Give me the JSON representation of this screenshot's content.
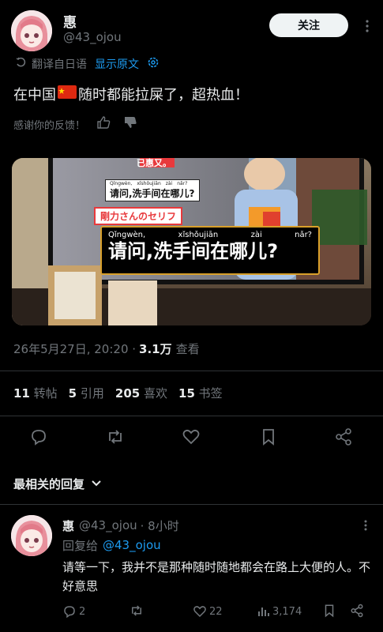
{
  "author": {
    "name": "惠",
    "handle": "@43_ojou"
  },
  "follow_label": "关注",
  "translate": {
    "label": "翻译自日语",
    "show_original": "显示原文"
  },
  "post_text": "在中国",
  "post_text2": "随时都能拉屎了，超热血！",
  "feedback": {
    "label": "感谢你的反馈！"
  },
  "media": {
    "banner": "已惠又。",
    "small_pinyin": [
      "Qǐngwèn,",
      "xǐshǒujiān",
      "zài",
      "nǎr?"
    ],
    "small_caption": "请问,洗手间在哪儿?",
    "tag": "剛力さんのセリフ",
    "pinyin": [
      "Qǐngwèn,",
      "xǐshǒujiān",
      "zài",
      "nǎr?"
    ],
    "caption": "请问,洗手间在哪儿?"
  },
  "meta": {
    "date": "26年5月27日, 20:20 ·",
    "views": "3.1万",
    "views_label": "查看"
  },
  "stats": [
    {
      "num": "11",
      "label": "转帖"
    },
    {
      "num": "5",
      "label": "引用"
    },
    {
      "num": "205",
      "label": "喜欢"
    },
    {
      "num": "15",
      "label": "书签"
    }
  ],
  "actions": [
    "reply-icon",
    "repost-icon",
    "like-icon",
    "bookmark-icon",
    "share-icon"
  ],
  "sort_label": "最相关的回复",
  "reply": {
    "name": "惠",
    "handle": "@43_ojou",
    "time": "· 8小时",
    "reply_to_prefix": "回复给",
    "reply_to_handle": "@43_ojou",
    "text": "请等一下，我并不是那种随时随地都会在路上大便的人。不好意思",
    "replies": "2",
    "likes": "22",
    "views": "3,174"
  },
  "colors": {
    "accent": "#1d9bf0",
    "background": "#000000",
    "text": "#e7e9ea",
    "muted": "#71767b"
  }
}
